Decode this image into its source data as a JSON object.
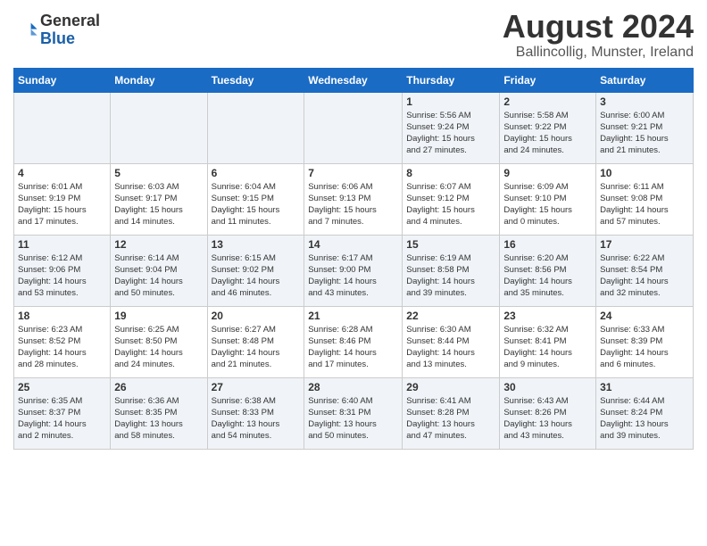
{
  "header": {
    "logo_general": "General",
    "logo_blue": "Blue",
    "title": "August 2024",
    "location": "Ballincollig, Munster, Ireland"
  },
  "calendar": {
    "days_of_week": [
      "Sunday",
      "Monday",
      "Tuesday",
      "Wednesday",
      "Thursday",
      "Friday",
      "Saturday"
    ],
    "weeks": [
      [
        {
          "day": "",
          "info": ""
        },
        {
          "day": "",
          "info": ""
        },
        {
          "day": "",
          "info": ""
        },
        {
          "day": "",
          "info": ""
        },
        {
          "day": "1",
          "info": "Sunrise: 5:56 AM\nSunset: 9:24 PM\nDaylight: 15 hours\nand 27 minutes."
        },
        {
          "day": "2",
          "info": "Sunrise: 5:58 AM\nSunset: 9:22 PM\nDaylight: 15 hours\nand 24 minutes."
        },
        {
          "day": "3",
          "info": "Sunrise: 6:00 AM\nSunset: 9:21 PM\nDaylight: 15 hours\nand 21 minutes."
        }
      ],
      [
        {
          "day": "4",
          "info": "Sunrise: 6:01 AM\nSunset: 9:19 PM\nDaylight: 15 hours\nand 17 minutes."
        },
        {
          "day": "5",
          "info": "Sunrise: 6:03 AM\nSunset: 9:17 PM\nDaylight: 15 hours\nand 14 minutes."
        },
        {
          "day": "6",
          "info": "Sunrise: 6:04 AM\nSunset: 9:15 PM\nDaylight: 15 hours\nand 11 minutes."
        },
        {
          "day": "7",
          "info": "Sunrise: 6:06 AM\nSunset: 9:13 PM\nDaylight: 15 hours\nand 7 minutes."
        },
        {
          "day": "8",
          "info": "Sunrise: 6:07 AM\nSunset: 9:12 PM\nDaylight: 15 hours\nand 4 minutes."
        },
        {
          "day": "9",
          "info": "Sunrise: 6:09 AM\nSunset: 9:10 PM\nDaylight: 15 hours\nand 0 minutes."
        },
        {
          "day": "10",
          "info": "Sunrise: 6:11 AM\nSunset: 9:08 PM\nDaylight: 14 hours\nand 57 minutes."
        }
      ],
      [
        {
          "day": "11",
          "info": "Sunrise: 6:12 AM\nSunset: 9:06 PM\nDaylight: 14 hours\nand 53 minutes."
        },
        {
          "day": "12",
          "info": "Sunrise: 6:14 AM\nSunset: 9:04 PM\nDaylight: 14 hours\nand 50 minutes."
        },
        {
          "day": "13",
          "info": "Sunrise: 6:15 AM\nSunset: 9:02 PM\nDaylight: 14 hours\nand 46 minutes."
        },
        {
          "day": "14",
          "info": "Sunrise: 6:17 AM\nSunset: 9:00 PM\nDaylight: 14 hours\nand 43 minutes."
        },
        {
          "day": "15",
          "info": "Sunrise: 6:19 AM\nSunset: 8:58 PM\nDaylight: 14 hours\nand 39 minutes."
        },
        {
          "day": "16",
          "info": "Sunrise: 6:20 AM\nSunset: 8:56 PM\nDaylight: 14 hours\nand 35 minutes."
        },
        {
          "day": "17",
          "info": "Sunrise: 6:22 AM\nSunset: 8:54 PM\nDaylight: 14 hours\nand 32 minutes."
        }
      ],
      [
        {
          "day": "18",
          "info": "Sunrise: 6:23 AM\nSunset: 8:52 PM\nDaylight: 14 hours\nand 28 minutes."
        },
        {
          "day": "19",
          "info": "Sunrise: 6:25 AM\nSunset: 8:50 PM\nDaylight: 14 hours\nand 24 minutes."
        },
        {
          "day": "20",
          "info": "Sunrise: 6:27 AM\nSunset: 8:48 PM\nDaylight: 14 hours\nand 21 minutes."
        },
        {
          "day": "21",
          "info": "Sunrise: 6:28 AM\nSunset: 8:46 PM\nDaylight: 14 hours\nand 17 minutes."
        },
        {
          "day": "22",
          "info": "Sunrise: 6:30 AM\nSunset: 8:44 PM\nDaylight: 14 hours\nand 13 minutes."
        },
        {
          "day": "23",
          "info": "Sunrise: 6:32 AM\nSunset: 8:41 PM\nDaylight: 14 hours\nand 9 minutes."
        },
        {
          "day": "24",
          "info": "Sunrise: 6:33 AM\nSunset: 8:39 PM\nDaylight: 14 hours\nand 6 minutes."
        }
      ],
      [
        {
          "day": "25",
          "info": "Sunrise: 6:35 AM\nSunset: 8:37 PM\nDaylight: 14 hours\nand 2 minutes."
        },
        {
          "day": "26",
          "info": "Sunrise: 6:36 AM\nSunset: 8:35 PM\nDaylight: 13 hours\nand 58 minutes."
        },
        {
          "day": "27",
          "info": "Sunrise: 6:38 AM\nSunset: 8:33 PM\nDaylight: 13 hours\nand 54 minutes."
        },
        {
          "day": "28",
          "info": "Sunrise: 6:40 AM\nSunset: 8:31 PM\nDaylight: 13 hours\nand 50 minutes."
        },
        {
          "day": "29",
          "info": "Sunrise: 6:41 AM\nSunset: 8:28 PM\nDaylight: 13 hours\nand 47 minutes."
        },
        {
          "day": "30",
          "info": "Sunrise: 6:43 AM\nSunset: 8:26 PM\nDaylight: 13 hours\nand 43 minutes."
        },
        {
          "day": "31",
          "info": "Sunrise: 6:44 AM\nSunset: 8:24 PM\nDaylight: 13 hours\nand 39 minutes."
        }
      ]
    ]
  }
}
